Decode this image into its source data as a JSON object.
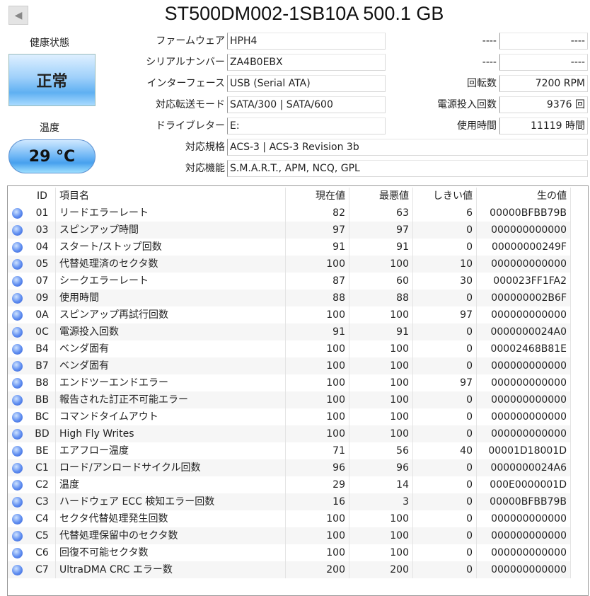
{
  "title": "ST500DM002-1SB10A 500.1 GB",
  "back_icon": "triangle-left",
  "health": {
    "label": "健康状態",
    "value": "正常",
    "color": "#5fb0f2"
  },
  "temperature": {
    "label": "温度",
    "value": "29 °C"
  },
  "info_left": [
    {
      "label": "ファームウェア",
      "value": "HPH4"
    },
    {
      "label": "シリアルナンバー",
      "value": "ZA4B0EBX"
    },
    {
      "label": "インターフェース",
      "value": "USB (Serial ATA)"
    },
    {
      "label": "対応転送モード",
      "value": "SATA/300 | SATA/600"
    },
    {
      "label": "ドライブレター",
      "value": "E:"
    }
  ],
  "info_right": [
    {
      "label": "----",
      "value": "----"
    },
    {
      "label": "----",
      "value": "----"
    },
    {
      "label": "回転数",
      "value": "7200 RPM"
    },
    {
      "label": "電源投入回数",
      "value": "9376 回"
    },
    {
      "label": "使用時間",
      "value": "11119 時間"
    }
  ],
  "info_wide": [
    {
      "label": "対応規格",
      "value": "ACS-3 | ACS-3 Revision 3b"
    },
    {
      "label": "対応機能",
      "value": "S.M.A.R.T., APM, NCQ, GPL"
    }
  ],
  "table": {
    "headers": [
      "",
      "ID",
      "項目名",
      "現在値",
      "最悪値",
      "しきい値",
      "生の値"
    ],
    "rows": [
      [
        "01",
        "リードエラーレート",
        "82",
        "63",
        "6",
        "00000BFBB79B"
      ],
      [
        "03",
        "スピンアップ時間",
        "97",
        "97",
        "0",
        "000000000000"
      ],
      [
        "04",
        "スタート/ストップ回数",
        "91",
        "91",
        "0",
        "00000000249F"
      ],
      [
        "05",
        "代替処理済のセクタ数",
        "100",
        "100",
        "10",
        "000000000000"
      ],
      [
        "07",
        "シークエラーレート",
        "87",
        "60",
        "30",
        "000023FF1FA2"
      ],
      [
        "09",
        "使用時間",
        "88",
        "88",
        "0",
        "000000002B6F"
      ],
      [
        "0A",
        "スピンアップ再試行回数",
        "100",
        "100",
        "97",
        "000000000000"
      ],
      [
        "0C",
        "電源投入回数",
        "91",
        "91",
        "0",
        "0000000024A0"
      ],
      [
        "B4",
        "ベンダ固有",
        "100",
        "100",
        "0",
        "00002468B81E"
      ],
      [
        "B7",
        "ベンダ固有",
        "100",
        "100",
        "0",
        "000000000000"
      ],
      [
        "B8",
        "エンドツーエンドエラー",
        "100",
        "100",
        "97",
        "000000000000"
      ],
      [
        "BB",
        "報告された訂正不可能エラー",
        "100",
        "100",
        "0",
        "000000000000"
      ],
      [
        "BC",
        "コマンドタイムアウト",
        "100",
        "100",
        "0",
        "000000000000"
      ],
      [
        "BD",
        "High Fly Writes",
        "100",
        "100",
        "0",
        "000000000000"
      ],
      [
        "BE",
        "エアフロー温度",
        "71",
        "56",
        "40",
        "00001D18001D"
      ],
      [
        "C1",
        "ロード/アンロードサイクル回数",
        "96",
        "96",
        "0",
        "0000000024A6"
      ],
      [
        "C2",
        "温度",
        "29",
        "14",
        "0",
        "000E0000001D"
      ],
      [
        "C3",
        "ハードウェア ECC 検知エラー回数",
        "16",
        "3",
        "0",
        "00000BFBB79B"
      ],
      [
        "C4",
        "セクタ代替処理発生回数",
        "100",
        "100",
        "0",
        "000000000000"
      ],
      [
        "C5",
        "代替処理保留中のセクタ数",
        "100",
        "100",
        "0",
        "000000000000"
      ],
      [
        "C6",
        "回復不可能セクタ数",
        "100",
        "100",
        "0",
        "000000000000"
      ],
      [
        "C7",
        "UltraDMA CRC エラー数",
        "200",
        "200",
        "0",
        "000000000000"
      ]
    ]
  }
}
